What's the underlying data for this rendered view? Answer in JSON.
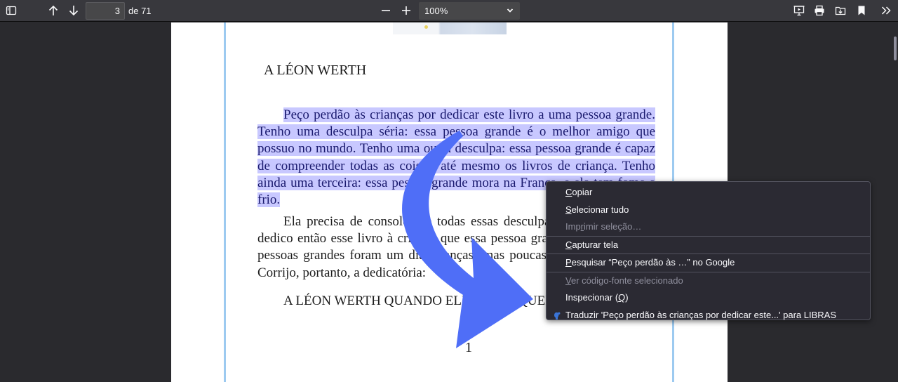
{
  "toolbar": {
    "page_current": "3",
    "page_of": "de 71",
    "zoom_value": "100%",
    "icons": {
      "sidebar": "sidebar-toggle-icon",
      "previous": "arrow-up-icon",
      "next": "arrow-down-icon",
      "zoom_out": "minus-icon",
      "zoom_in": "plus-icon",
      "presentation": "presentation-icon",
      "print": "printer-icon",
      "save": "save-download-icon",
      "bookmark": "bookmark-icon",
      "more": "chevron-double-right-icon"
    }
  },
  "document": {
    "heading": "A LÉON WERTH",
    "para1_selected": "Peço perdão às crianças por dedicar este livro a uma pessoa grande. Tenho uma desculpa séria: essa pessoa grande é o melhor amigo que possuo no mundo. Tenho uma outra desculpa: essa pessoa grande é capaz de compreender todas as coisas, até mesmo os livros de criança. Tenho ainda uma terceira: essa pessoa grande mora na França, e ela tem fome e frio.",
    "para2": "Ela precisa de consolo. Se todas essas desculpas não bastarem, eu dedico então esse livro à criança que essa pessoa grande já foi. Todas as pessoas grandes foram um dia crianças (mas poucas se lembram disso). Corrijo, portanto, a dedicatória:",
    "heading2": "A LÉON WERTH QUANDO ELE ERA PEQUENINO",
    "page_number": "1"
  },
  "context_menu": {
    "items": [
      {
        "prefix": "",
        "accel": "C",
        "rest": "opiar",
        "disabled": false
      },
      {
        "prefix": "",
        "accel": "S",
        "rest": "elecionar tudo",
        "disabled": false
      },
      {
        "prefix": "Imp",
        "accel": "r",
        "rest": "imir seleção…",
        "disabled": true
      },
      {
        "prefix": "",
        "accel": "C",
        "rest": "apturar tela",
        "disabled": false
      },
      {
        "prefix": "",
        "accel": "P",
        "rest": "esquisar “Peço perdão às …” no Google",
        "disabled": false
      },
      {
        "prefix": "",
        "accel": "V",
        "rest": "er código-fonte selecionado",
        "disabled": true
      },
      {
        "prefix": "Inspecionar (",
        "accel": "Q",
        "rest": ")",
        "disabled": false
      },
      {
        "prefix": "",
        "accel": "",
        "rest": "Traduzir 'Peço perdão às crianças por dedicar este...' para LIBRAS",
        "disabled": false
      }
    ],
    "translate_icon": "libras-hand-icon"
  },
  "colors": {
    "selection": "#c8c8ff",
    "arrow": "#4f6ef7",
    "page_border": "#9dcaf0"
  }
}
